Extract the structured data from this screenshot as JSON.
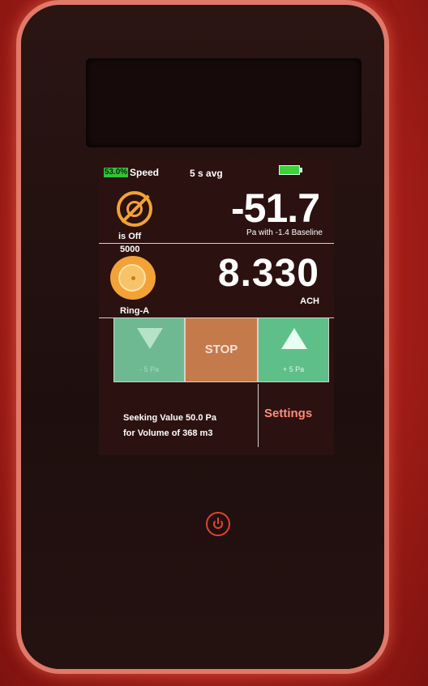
{
  "status": {
    "speed_pct": "53.0%",
    "speed_label": "Speed",
    "avg_label": "5 s avg"
  },
  "pressure": {
    "value": "-51.7",
    "subtitle": "Pa with -1.4 Baseline",
    "ring_status": "is Off"
  },
  "flow": {
    "range_label": "5000",
    "value": "8.330",
    "unit": "ACH",
    "ring_label": "Ring-A"
  },
  "controls": {
    "down_label": "- 5 Pa",
    "stop_label": "STOP",
    "up_label": "+ 5 Pa"
  },
  "target": {
    "line1": "Seeking Value  50.0 Pa",
    "line2": "for Volume of 368 m3"
  },
  "settings_label": "Settings",
  "colors": {
    "accent_orange": "#f2a236",
    "button_green": "#5ebf88",
    "button_stop": "#c57a4c",
    "settings_text": "#ff8a7a",
    "battery_green": "#3dd13a"
  },
  "icons": [
    "ring-off-icon",
    "fan-icon",
    "arrow-down-icon",
    "arrow-up-icon",
    "battery-icon",
    "power-icon"
  ]
}
